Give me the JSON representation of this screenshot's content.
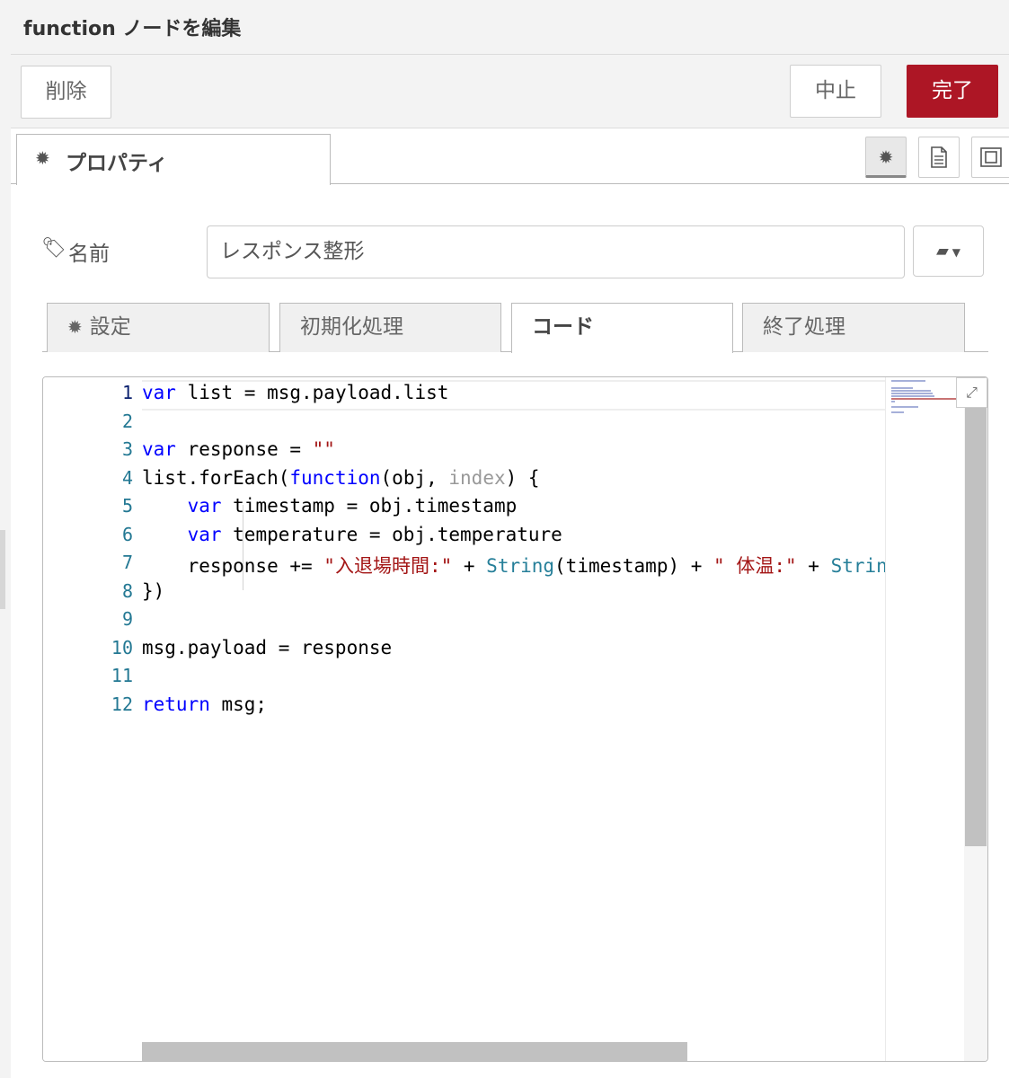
{
  "header": {
    "title": "function ノードを編集"
  },
  "toolbar": {
    "delete_label": "削除",
    "cancel_label": "中止",
    "done_label": "完了",
    "done_color": "#ad1625"
  },
  "tabs": {
    "properties_label": "プロパティ",
    "properties_icon": "gear-icon",
    "icon_tabs": [
      "gear-icon",
      "document-icon",
      "layout-icon"
    ]
  },
  "name_field": {
    "label": "名前",
    "icon": "tag-icon",
    "value": "レスポンス整形",
    "library_icon": "book-icon"
  },
  "sub_tabs": [
    {
      "label": "設定",
      "icon": "gear-icon"
    },
    {
      "label": "初期化処理"
    },
    {
      "label": "コード",
      "active": true
    },
    {
      "label": "終了処理"
    }
  ],
  "editor": {
    "current_line": 1,
    "lines": [
      "var list = msg.payload.list",
      "",
      "var response = \"\"",
      "list.forEach(function(obj, index) {",
      "    var timestamp = obj.timestamp",
      "    var temperature = obj.temperature",
      "    response += \"入退場時間:\" + String(timestamp) + \" 体温:\" + Strin",
      "})",
      "",
      "msg.payload = response",
      "",
      "return msg;"
    ],
    "line_numbers": [
      "1",
      "2",
      "3",
      "4",
      "5",
      "6",
      "7",
      "8",
      "9",
      "10",
      "11",
      "12"
    ],
    "expand_icon": "expand-icon"
  }
}
